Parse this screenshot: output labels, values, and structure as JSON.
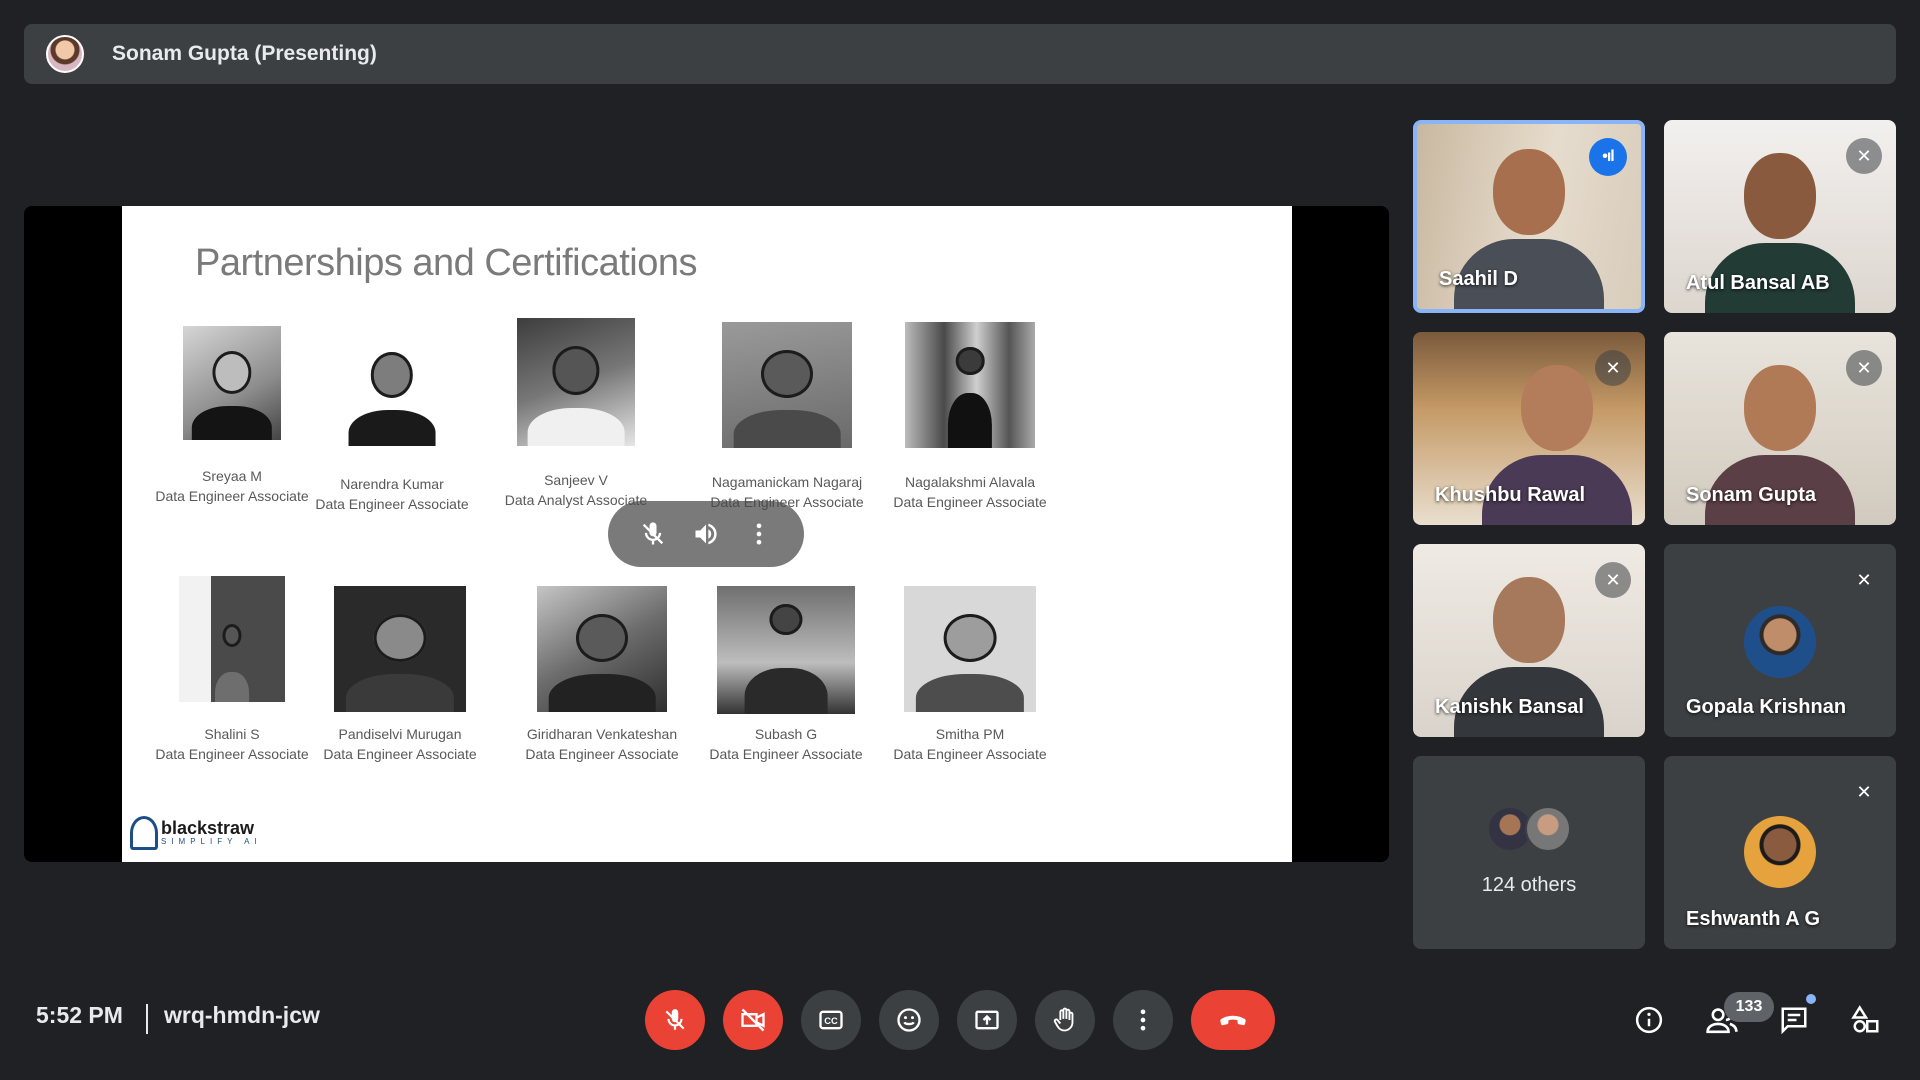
{
  "presenter_bar": {
    "label": "Sonam Gupta (Presenting)"
  },
  "slide": {
    "title": "Partnerships and Certifications",
    "people": [
      {
        "name": "Sreyaa M",
        "role": "Data Engineer Associate"
      },
      {
        "name": "Narendra Kumar",
        "role": "Data Engineer Associate"
      },
      {
        "name": "Sanjeev V",
        "role": "Data Analyst Associate"
      },
      {
        "name": "Nagamanickam Nagaraj",
        "role": "Data Engineer Associate"
      },
      {
        "name": "Nagalakshmi Alavala",
        "role": "Data Engineer Associate"
      },
      {
        "name": "Shalini S",
        "role": "Data Engineer Associate"
      },
      {
        "name": "Pandiselvi Murugan",
        "role": "Data Engineer Associate"
      },
      {
        "name": "Giridharan Venkateshan",
        "role": "Data Engineer Associate"
      },
      {
        "name": "Subash G",
        "role": "Data Engineer Associate"
      },
      {
        "name": "Smitha PM",
        "role": "Data Engineer Associate"
      }
    ],
    "logo": {
      "main": "blackstraw",
      "sub": "SIMPLIFY AI"
    }
  },
  "overlay_controls": {
    "icons": [
      "mic-off-icon",
      "volume-icon",
      "more-vert-icon"
    ]
  },
  "participants": [
    {
      "name": "Saahil D",
      "status": "speaking"
    },
    {
      "name": "Atul Bansal AB",
      "status": "muted"
    },
    {
      "name": "Khushbu Rawal",
      "status": "muted"
    },
    {
      "name": "Sonam Gupta",
      "status": "muted"
    },
    {
      "name": "Kanishk Bansal",
      "status": "muted"
    },
    {
      "name": "Gopala Krishnan",
      "status": "muted"
    },
    {
      "name": "124 others",
      "status": ""
    },
    {
      "name": "Eshwanth A G",
      "status": "muted"
    }
  ],
  "bottom_bar": {
    "time": "5:52 PM",
    "meeting_code": "wrq-hmdn-jcw",
    "participant_count": "133"
  },
  "colors": {
    "background": "#202124",
    "surface": "#3c4043",
    "danger": "#ea4335",
    "accent": "#8ab4f8",
    "speaking": "#1a73e8"
  }
}
